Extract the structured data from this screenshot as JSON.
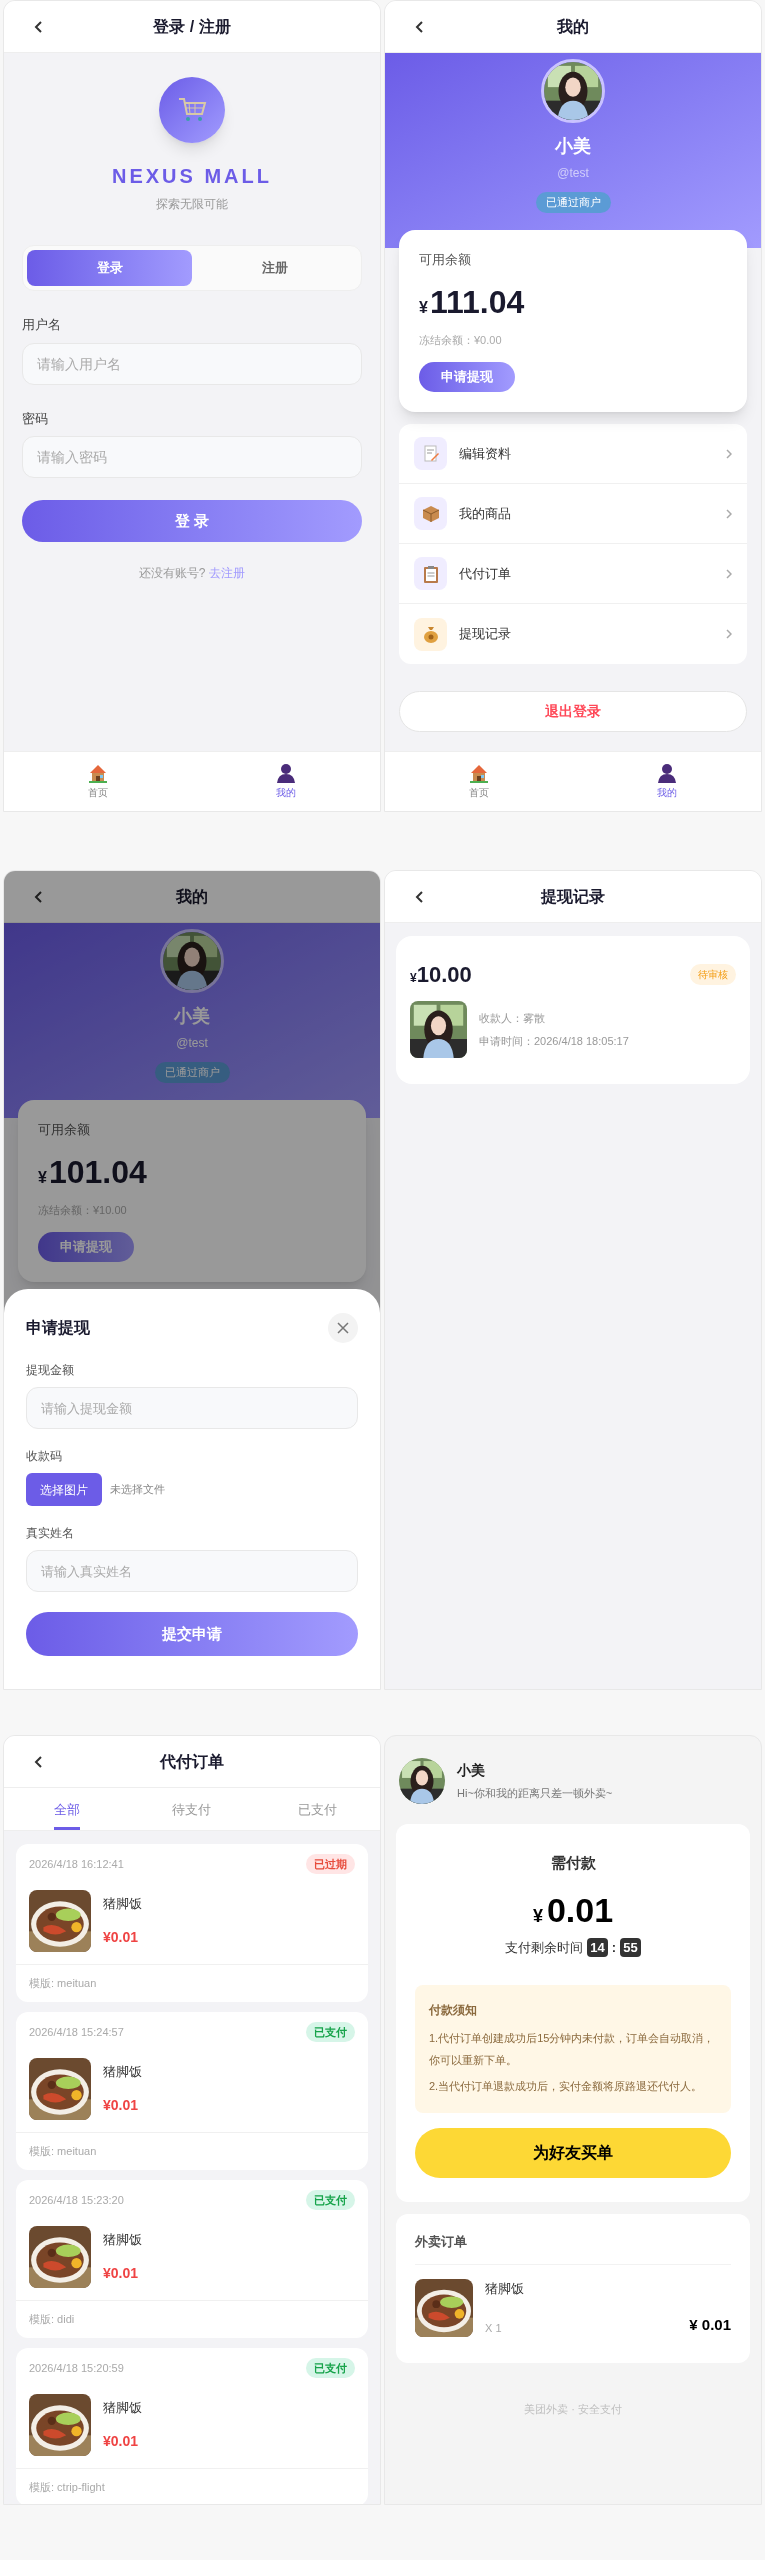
{
  "login_screen": {
    "title": "登录 / 注册",
    "brand": "NEXUS MALL",
    "slogan": "探索无限可能",
    "tabs": [
      {
        "label": "登录",
        "selected": true
      },
      {
        "label": "注册",
        "selected": false
      }
    ],
    "fields": [
      {
        "label": "用户名",
        "placeholder": "请输入用户名"
      },
      {
        "label": "密码",
        "placeholder": "请输入密码"
      }
    ],
    "submit": "登 录",
    "prompt": "还没有账号?",
    "prompt_link": "去注册",
    "bottom_nav": [
      {
        "label": "首页",
        "selected": false
      },
      {
        "label": "我的",
        "selected": true
      }
    ]
  },
  "profile_screen": {
    "title": "我的",
    "name": "小美",
    "handle": "@test",
    "badge": "已通过商户",
    "balance": {
      "label": "可用余额",
      "currency": "¥",
      "amount": "111.04",
      "frozen": "冻结余额：¥0.00",
      "button": "申请提现"
    },
    "menu": [
      {
        "label": "编辑资料"
      },
      {
        "label": "我的商品"
      },
      {
        "label": "代付订单"
      },
      {
        "label": "提现记录"
      }
    ],
    "logout": "退出登录",
    "bottom_nav": [
      {
        "label": "首页",
        "selected": false
      },
      {
        "label": "我的",
        "selected": true
      }
    ]
  },
  "withdraw_dialog_screen": {
    "title": "我的",
    "name": "小美",
    "handle": "@test",
    "badge": "已通过商户",
    "balance": {
      "label": "可用余额",
      "currency": "¥",
      "amount": "101.04",
      "frozen": "冻结余额：¥10.00",
      "button": "申请提现"
    },
    "dialog": {
      "title": "申请提现",
      "fields": [
        {
          "kind": "input",
          "label": "提现金额",
          "placeholder": "请输入提现金额"
        },
        {
          "kind": "file",
          "label": "收款码",
          "button": "选择图片",
          "status": "未选择文件"
        },
        {
          "kind": "input",
          "label": "真实姓名",
          "placeholder": "请输入真实姓名"
        }
      ],
      "submit": "提交申请"
    }
  },
  "withdraw_records_screen": {
    "title": "提现记录",
    "records": [
      {
        "currency": "¥",
        "amount": "10.00",
        "status": "待审核",
        "payee": "收款人：雾散",
        "time": "申请时间：2026/4/18 18:05:17"
      }
    ]
  },
  "proxy_orders_screen": {
    "title": "代付订单",
    "tabs": [
      {
        "label": "全部",
        "selected": true
      },
      {
        "label": "待支付",
        "selected": false
      },
      {
        "label": "已支付",
        "selected": false
      }
    ],
    "orders": [
      {
        "time": "2026/4/18 16:12:41",
        "status": "已过期",
        "kind": "expired",
        "item": "猪脚饭",
        "price": "¥0.01",
        "template": "模版: meituan"
      },
      {
        "time": "2026/4/18 15:24:57",
        "status": "已支付",
        "kind": "paid",
        "item": "猪脚饭",
        "price": "¥0.01",
        "template": "模版: meituan"
      },
      {
        "time": "2026/4/18 15:23:20",
        "status": "已支付",
        "kind": "paid",
        "item": "猪脚饭",
        "price": "¥0.01",
        "template": "模版: didi"
      },
      {
        "time": "2026/4/18 15:20:59",
        "status": "已支付",
        "kind": "paid",
        "item": "猪脚饭",
        "price": "¥0.01",
        "template": "模版: ctrip-flight"
      }
    ]
  },
  "payment_screen": {
    "name": "小美",
    "greeting": "Hi~你和我的距离只差一顿外卖~",
    "due": {
      "title": "需付款",
      "currency": "¥",
      "amount": "0.01",
      "countdown_label": "支付剩余时间",
      "minutes": "14",
      "separator": ":",
      "seconds": "55"
    },
    "notice": {
      "title": "付款须知",
      "lines": [
        "1.代付订单创建成功后15分钟内未付款，订单会自动取消，你可以重新下单。",
        "2.当代付订单退款成功后，实付金额将原路退还代付人。"
      ]
    },
    "button": "为好友买单",
    "order": {
      "title": "外卖订单",
      "items": [
        {
          "name": "猪脚饭",
          "qty": "X 1",
          "price": "¥ 0.01"
        }
      ]
    },
    "footer": "美团外卖 · 安全支付"
  }
}
